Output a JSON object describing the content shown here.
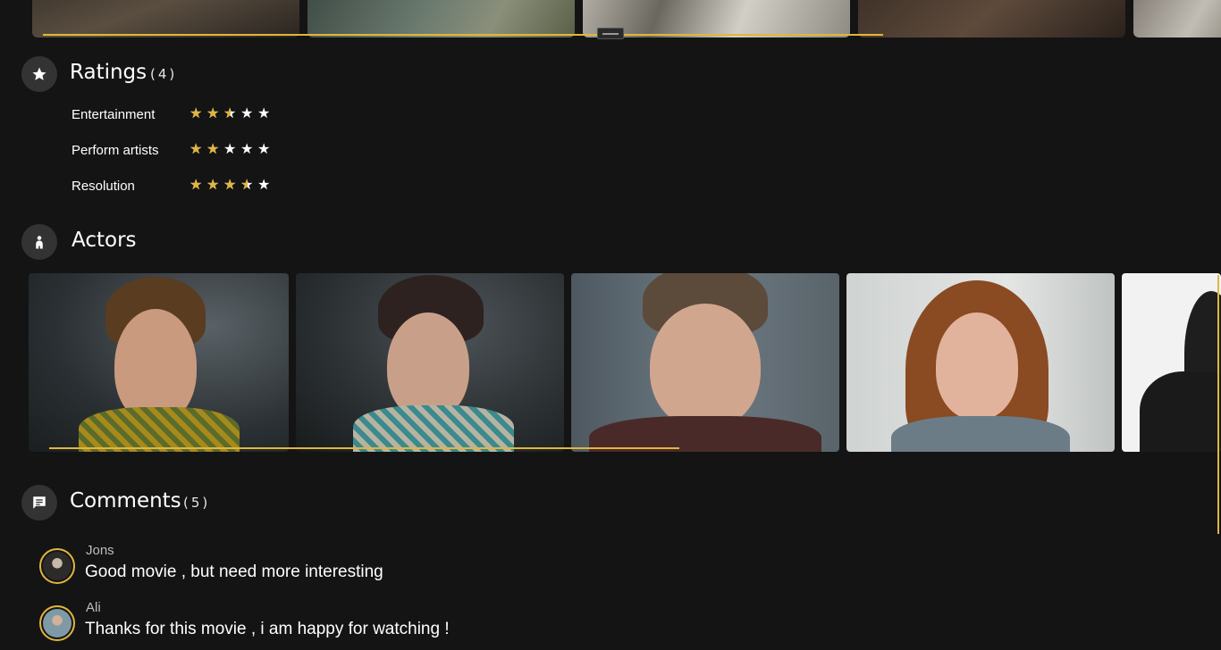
{
  "scenes": {
    "items": [
      {
        "name": "scene-1"
      },
      {
        "name": "scene-2"
      },
      {
        "name": "scene-3"
      },
      {
        "name": "scene-4"
      },
      {
        "name": "scene-5"
      }
    ]
  },
  "ratings": {
    "title": "Ratings",
    "count": "(4)",
    "icon": "star-icon",
    "items": [
      {
        "label": "Entertainment",
        "value": 2.5,
        "max": 5
      },
      {
        "label": "Perform artists",
        "value": 2,
        "max": 5
      },
      {
        "label": "Resolution",
        "value": 3.5,
        "max": 5
      }
    ]
  },
  "actors": {
    "title": "Actors",
    "icon": "person-icon"
  },
  "comments": {
    "title": "Comments",
    "count": "(5)",
    "icon": "comment-icon",
    "items": [
      {
        "author": "Jons",
        "text": "Good movie , but need more interesting"
      },
      {
        "author": "Ali",
        "text": "Thanks for  this movie , i am happy for watching !"
      }
    ]
  },
  "colors": {
    "background": "#141414",
    "accent": "#e2b63b",
    "icon_bg": "#333333",
    "star_empty": "#ffffff"
  }
}
